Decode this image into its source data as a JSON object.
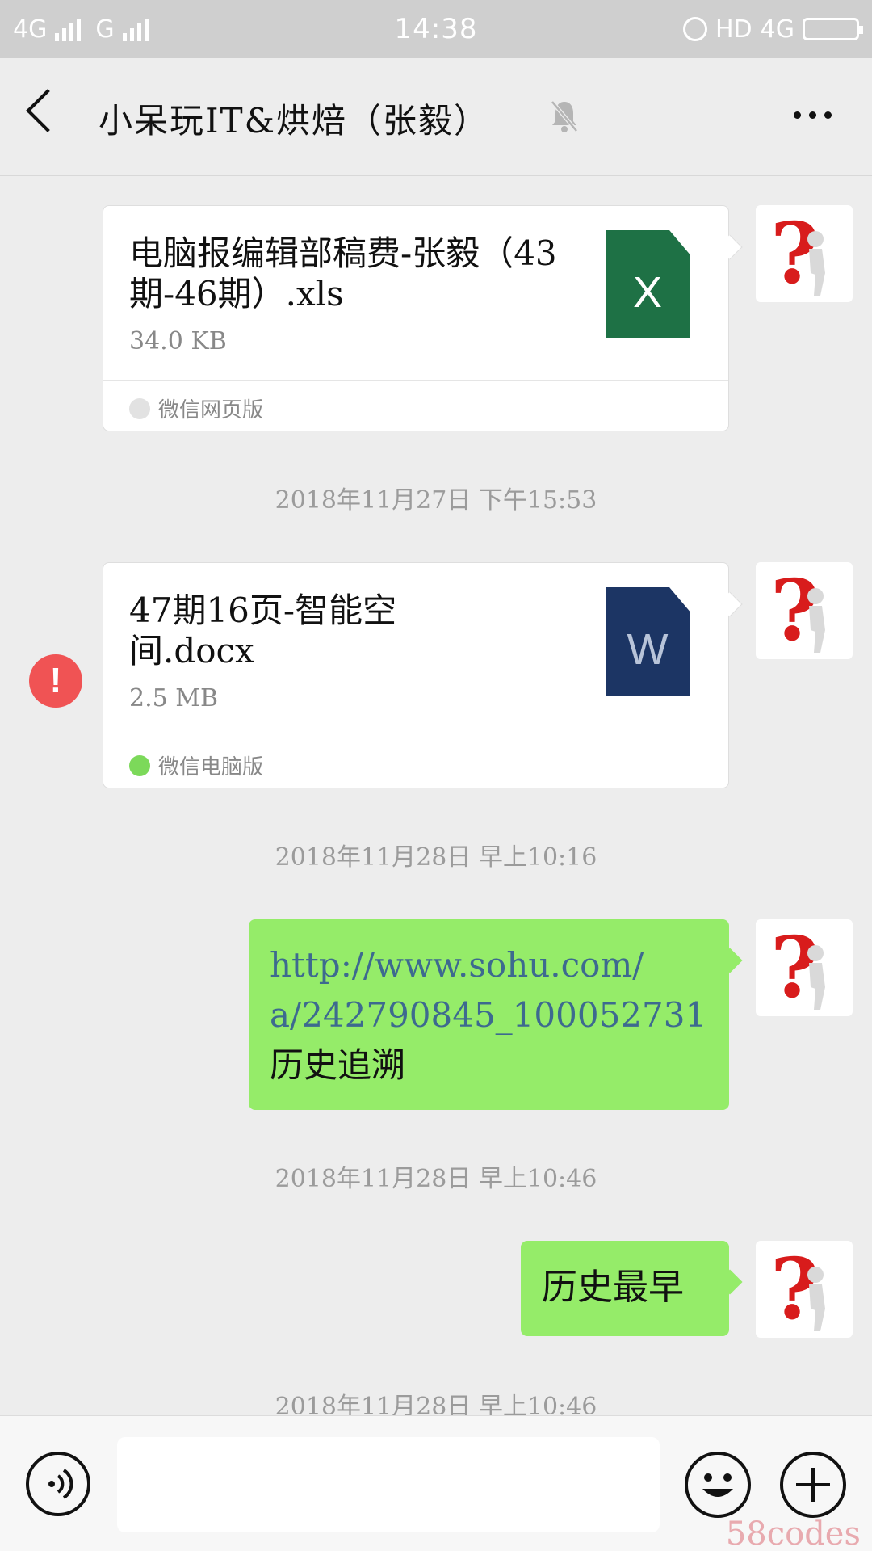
{
  "status_bar": {
    "left_network_1": "4G",
    "left_network_2": "G",
    "time": "14:38",
    "hd": "HD",
    "right_network": "4G"
  },
  "header": {
    "title": "小呆玩IT&烘焙（张毅）",
    "back_icon": "chevron-left-icon",
    "mute_icon": "bell-off-icon",
    "more_icon": "more-dots-icon"
  },
  "messages": [
    {
      "type": "file",
      "file_name": "电脑报编辑部稿费-张毅（43期-46期）.xls",
      "file_size": "34.0 KB",
      "source": "微信网页版",
      "file_icon_letter": "X"
    },
    {
      "type": "timestamp",
      "text": "2018年11月27日 下午15:53"
    },
    {
      "type": "file",
      "file_name": "47期16页-智能空间.docx",
      "file_size": "2.5 MB",
      "source": "微信电脑版",
      "file_icon_letter": "W",
      "error": "!"
    },
    {
      "type": "timestamp",
      "text": "2018年11月28日 早上10:16"
    },
    {
      "type": "text",
      "link_line1": "http://www.sohu.com/",
      "link_line2": "a/242790845_100052731",
      "text": "历史追溯"
    },
    {
      "type": "timestamp",
      "text": "2018年11月28日 早上10:46"
    },
    {
      "type": "text",
      "text": "历史最早"
    },
    {
      "type": "timestamp",
      "text": "2018年11月28日 早上10:46"
    }
  ],
  "bottom_bar": {
    "voice_icon": "voice-icon",
    "emoji_icon": "emoji-icon",
    "plus_icon": "plus-icon",
    "input_value": ""
  },
  "watermark": "58codes",
  "colors": {
    "bubble_green": "#95ec69",
    "excel_green": "#1e7145",
    "word_blue": "#1c3564",
    "error_red": "#f05354"
  }
}
